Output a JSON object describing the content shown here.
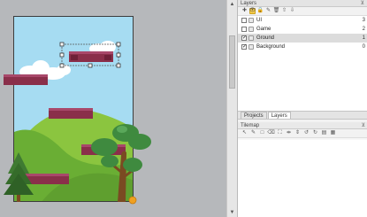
{
  "layers_panel": {
    "title": "Layers",
    "pin_icon": "pin-icon",
    "toolbar_icons": [
      "add-layer-icon",
      "visibility-icon",
      "lock-icon",
      "edit-icon",
      "delete-icon",
      "move-up-icon",
      "move-down-icon"
    ],
    "layers": [
      {
        "name": "UI",
        "count": "3",
        "visible": false,
        "selected": false
      },
      {
        "name": "Game",
        "count": "2",
        "visible": false,
        "selected": false
      },
      {
        "name": "Ground",
        "count": "1",
        "visible": true,
        "selected": true
      },
      {
        "name": "Background",
        "count": "0",
        "visible": true,
        "selected": false
      }
    ]
  },
  "tabs": [
    {
      "label": "Projects",
      "active": false
    },
    {
      "label": "Layers",
      "active": true
    }
  ],
  "tilemap_panel": {
    "title": "Tilemap",
    "pin_icon": "pin-icon"
  },
  "colors": {
    "sky": "#a6dcf2",
    "hill_dark": "#5f9f2f",
    "hill_light": "#8bc53f",
    "platform": "#8a2f4a",
    "tree_green": "#3f8a3f",
    "trunk": "#7a4a22",
    "accent": "#ffd24a"
  }
}
